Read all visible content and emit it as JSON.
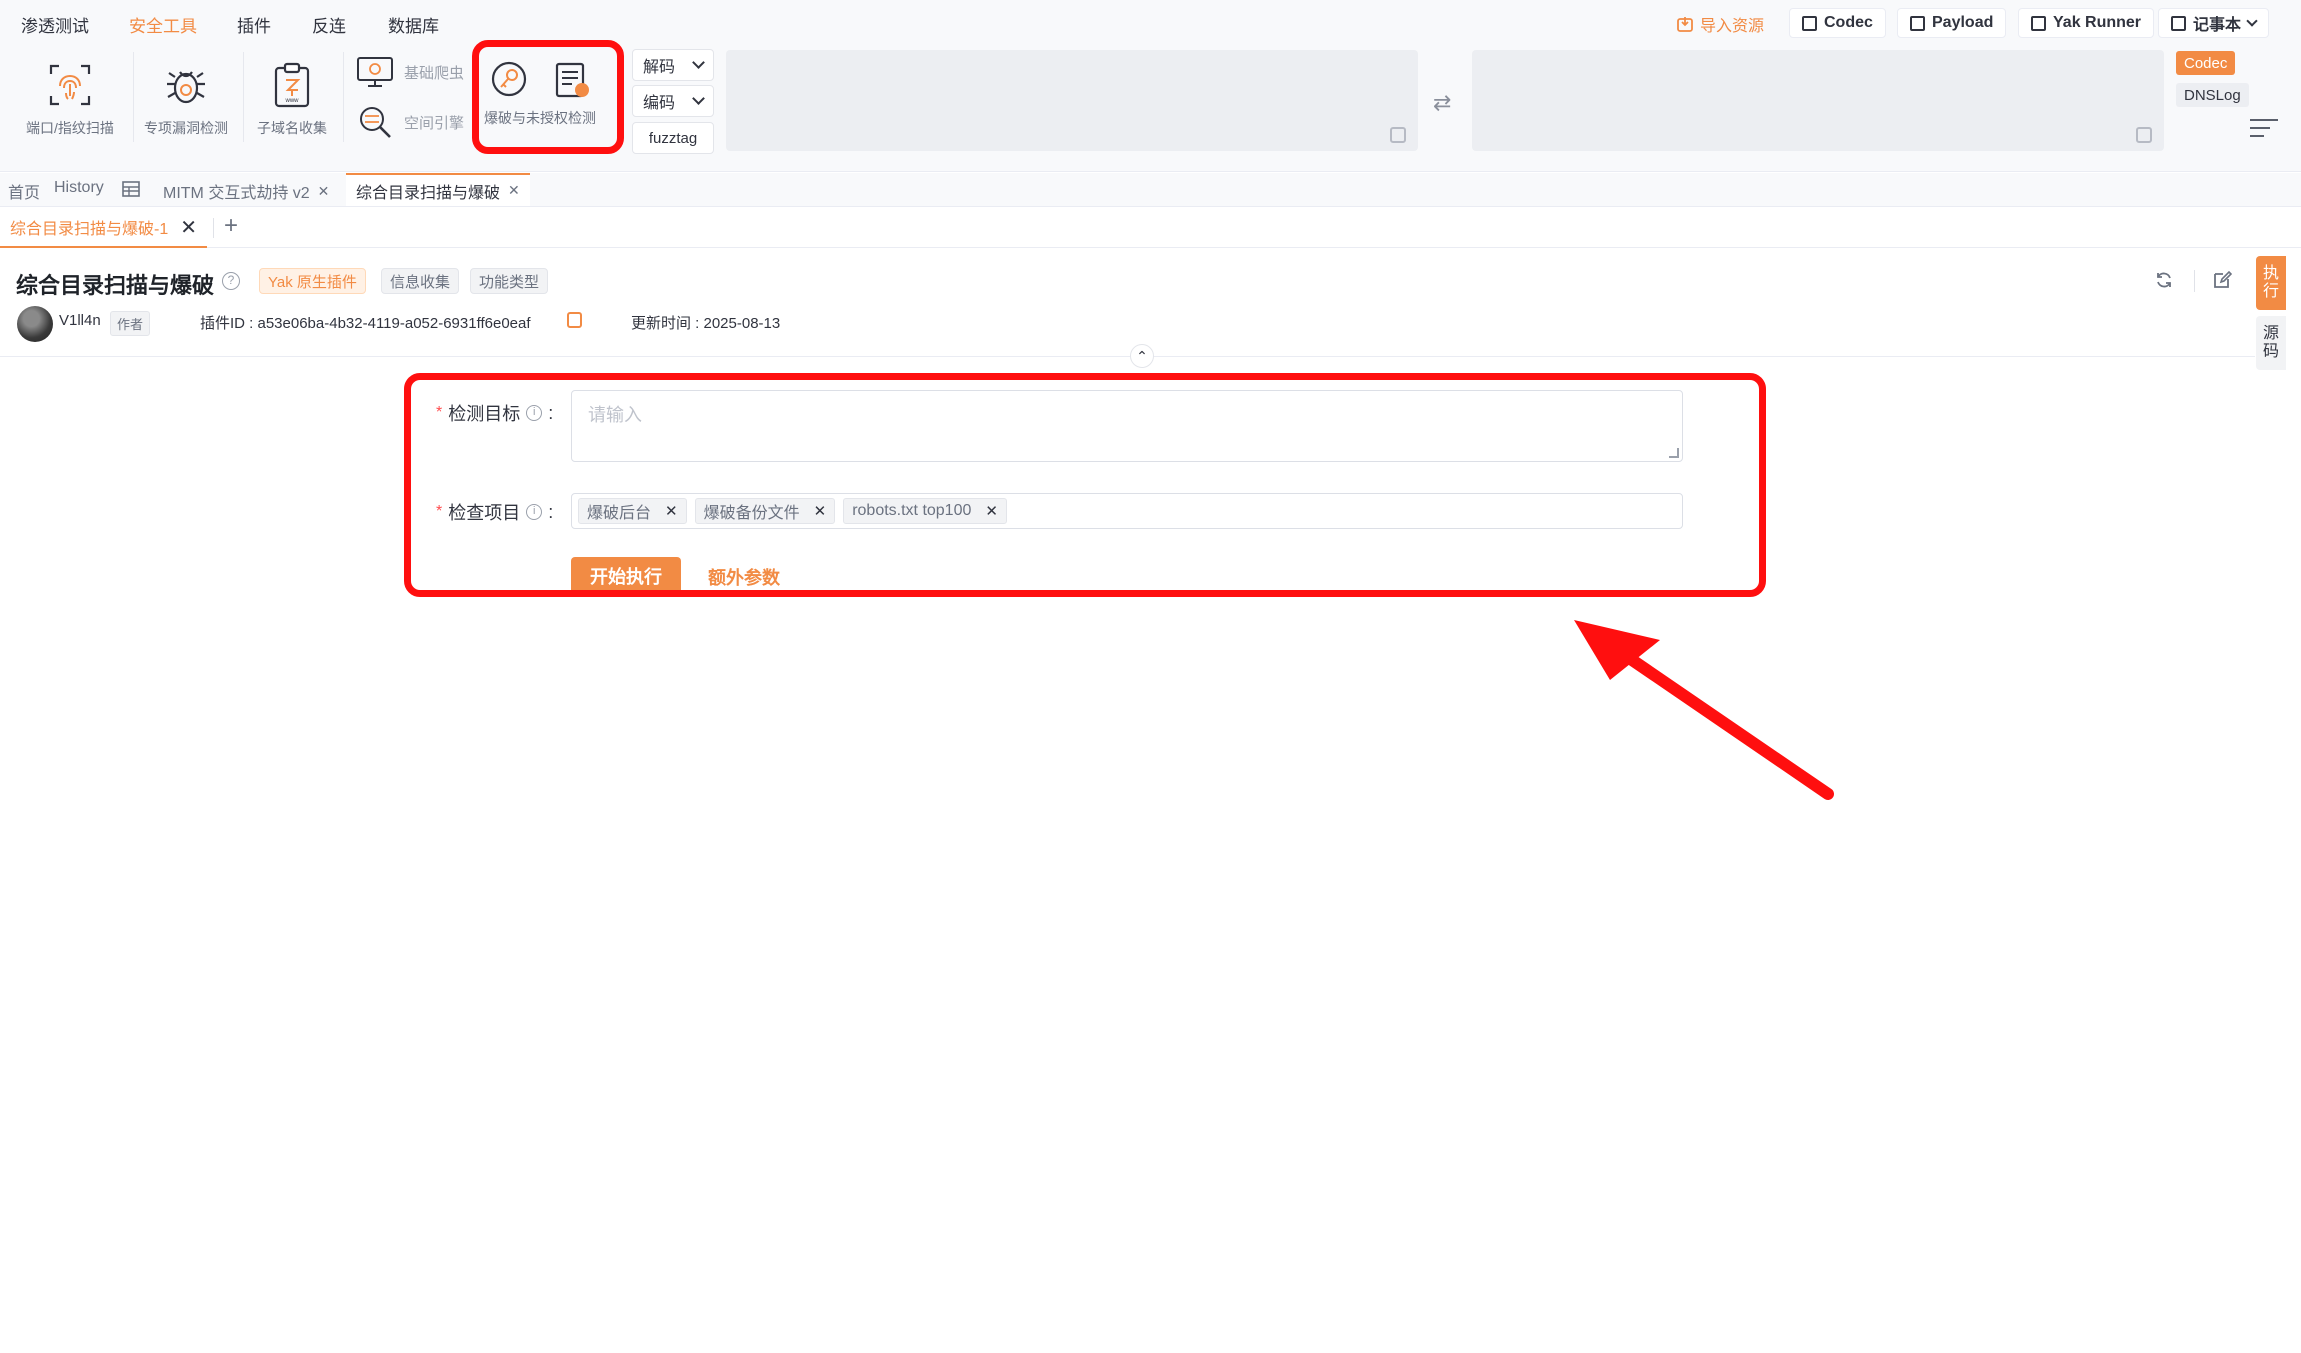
{
  "menu": [
    "渗透测试",
    "安全工具",
    "插件",
    "反连",
    "数据库"
  ],
  "top_right": {
    "import": "导入资源",
    "codec": "Codec",
    "payload": "Payload",
    "yak_runner": "Yak Runner",
    "notebook": "记事本"
  },
  "tools": {
    "port_scan": "端口/指纹扫描",
    "vuln_detect": "专项漏洞检测",
    "subdomain": "子域名收集",
    "crawler": "基础爬虫",
    "space_engine": "空间引擎",
    "brute": "爆破与未授权检测"
  },
  "codec_panel": {
    "decode": "解码",
    "encode": "编码",
    "fuzztag": "fuzztag",
    "tag_codec": "Codec",
    "tag_dnslog": "DNSLog"
  },
  "tabs": {
    "home": "首页",
    "history": "History",
    "mitm": "MITM 交互式劫持 v2",
    "active": "综合目录扫描与爆破",
    "sub_active": "综合目录扫描与爆破-1"
  },
  "plugin": {
    "title": "综合目录扫描与爆破",
    "tags": [
      "Yak 原生插件",
      "信息收集",
      "功能类型"
    ],
    "author": "V1ll4n",
    "author_tag": "作者",
    "plugin_id": "插件ID : a53e06ba-4b32-4119-a052-6931ff6e0eaf",
    "updated": "更新时间 : 2025-08-13",
    "side_exec": [
      "执",
      "行"
    ],
    "side_src": [
      "源",
      "码"
    ]
  },
  "form": {
    "target_label": "检测目标",
    "target_placeholder": "请输入",
    "items_label": "检查项目",
    "chips": [
      "爆破后台",
      "爆破备份文件",
      "robots.txt top100"
    ],
    "run": "开始执行",
    "extra": "额外参数"
  },
  "colors": {
    "accent": "#f28b44",
    "annotation": "#ff0f0f"
  }
}
